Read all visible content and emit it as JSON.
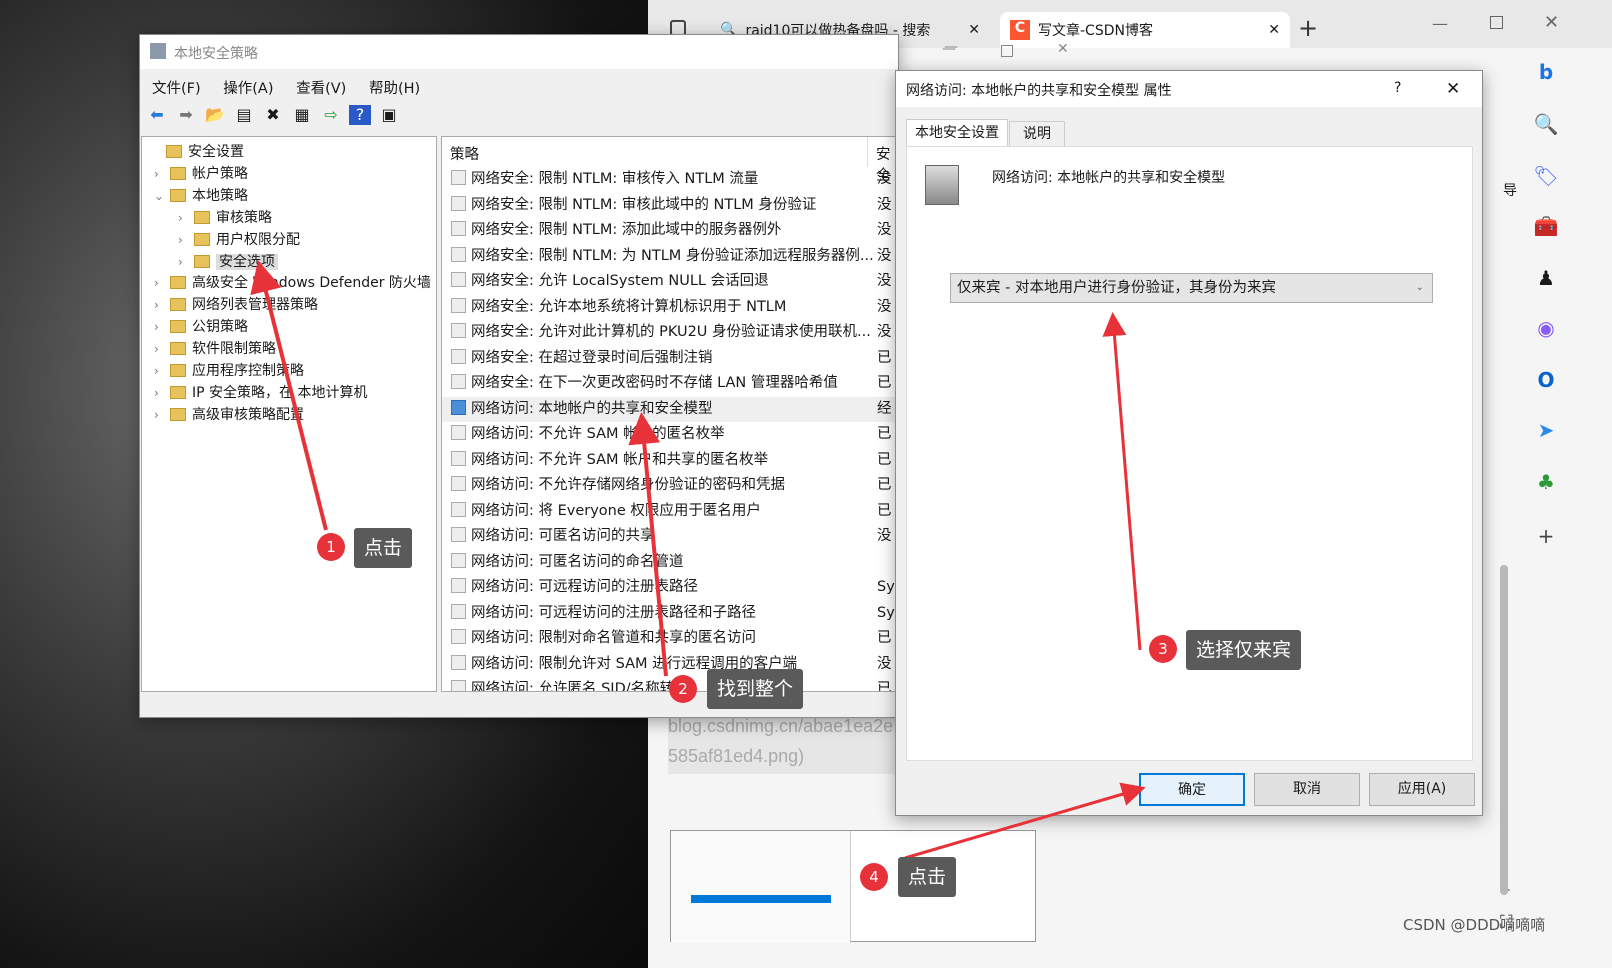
{
  "browser": {
    "tabs": [
      {
        "label": "raid10可以做热备盘吗 - 搜索",
        "icon": "search-icon"
      },
      {
        "label": "写文章-CSDN博客",
        "icon": "csdn-icon"
      }
    ],
    "new_tab": "+",
    "content_text_1": "blog.csdnimg.cn/abae1ea2e",
    "content_text_2": "585af81ed4.png)",
    "side_label": "导",
    "sidebar_icons": [
      "bing-icon",
      "search-icon",
      "tag-icon",
      "toolbox-icon",
      "chess-icon",
      "office-icon",
      "outlook-icon",
      "send-icon",
      "tree-icon",
      "plus-icon"
    ]
  },
  "mmc": {
    "title": "本地安全策略",
    "menu": [
      "文件(F)",
      "操作(A)",
      "查看(V)",
      "帮助(H)"
    ],
    "tree": [
      {
        "label": "安全设置",
        "level": 0
      },
      {
        "label": "帐户策略",
        "level": 1
      },
      {
        "label": "本地策略",
        "level": 1,
        "expanded": true
      },
      {
        "label": "审核策略",
        "level": 2
      },
      {
        "label": "用户权限分配",
        "level": 2
      },
      {
        "label": "安全选项",
        "level": 2,
        "selected": true
      },
      {
        "label": "高级安全 Windows Defender 防火墙",
        "level": 1
      },
      {
        "label": "网络列表管理器策略",
        "level": 1
      },
      {
        "label": "公钥策略",
        "level": 1
      },
      {
        "label": "软件限制策略",
        "level": 1
      },
      {
        "label": "应用程序控制策略",
        "level": 1
      },
      {
        "label": "IP 安全策略，在 本地计算机",
        "level": 1
      },
      {
        "label": "高级审核策略配置",
        "level": 1
      }
    ],
    "columns": [
      "策略",
      "安全"
    ],
    "rows": [
      {
        "policy": "网络安全: 限制 NTLM: 审核传入 NTLM 流量",
        "setting": "没"
      },
      {
        "policy": "网络安全: 限制 NTLM: 审核此域中的 NTLM 身份验证",
        "setting": "没"
      },
      {
        "policy": "网络安全: 限制 NTLM: 添加此域中的服务器例外",
        "setting": "没"
      },
      {
        "policy": "网络安全: 限制 NTLM: 为 NTLM 身份验证添加远程服务器例...",
        "setting": "没"
      },
      {
        "policy": "网络安全: 允许 LocalSystem NULL 会话回退",
        "setting": "没"
      },
      {
        "policy": "网络安全: 允许本地系统将计算机标识用于 NTLM",
        "setting": "没"
      },
      {
        "policy": "网络安全: 允许对此计算机的 PKU2U 身份验证请求使用联机...",
        "setting": "没"
      },
      {
        "policy": "网络安全: 在超过登录时间后强制注销",
        "setting": "已"
      },
      {
        "policy": "网络安全: 在下一次更改密码时不存储 LAN 管理器哈希值",
        "setting": "已"
      },
      {
        "policy": "网络访问: 本地帐户的共享和安全模型",
        "setting": "经",
        "selected": true
      },
      {
        "policy": "网络访问: 不允许 SAM 帐户的匿名枚举",
        "setting": "已"
      },
      {
        "policy": "网络访问: 不允许 SAM 帐户和共享的匿名枚举",
        "setting": "已"
      },
      {
        "policy": "网络访问: 不允许存储网络身份验证的密码和凭据",
        "setting": "已"
      },
      {
        "policy": "网络访问: 将 Everyone 权限应用于匿名用户",
        "setting": "已"
      },
      {
        "policy": "网络访问: 可匿名访问的共享",
        "setting": "没"
      },
      {
        "policy": "网络访问: 可匿名访问的命名管道",
        "setting": ""
      },
      {
        "policy": "网络访问: 可远程访问的注册表路径",
        "setting": "Sys"
      },
      {
        "policy": "网络访问: 可远程访问的注册表路径和子路径",
        "setting": "Sys"
      },
      {
        "policy": "网络访问: 限制对命名管道和共享的匿名访问",
        "setting": "已"
      },
      {
        "policy": "网络访问: 限制允许对 SAM 进行远程调用的客户端",
        "setting": "没"
      },
      {
        "policy": "网络访问: 允许匿名 SID/名称转换",
        "setting": "已"
      }
    ]
  },
  "dialog": {
    "title": "网络访问: 本地帐户的共享和安全模型 属性",
    "help": "?",
    "tabs": [
      "本地安全设置",
      "说明"
    ],
    "policy_name": "网络访问: 本地帐户的共享和安全模型",
    "select_value": "仅来宾 - 对本地用户进行身份验证，其身份为来宾",
    "buttons": {
      "ok": "确定",
      "cancel": "取消",
      "apply": "应用(A)"
    }
  },
  "annotations": [
    {
      "number": "1",
      "text": "点击"
    },
    {
      "number": "2",
      "text": "找到整个"
    },
    {
      "number": "3",
      "text": "选择仅来宾"
    },
    {
      "number": "4",
      "text": "点击"
    }
  ],
  "annotation_color": "#e8323a",
  "watermark": "CSDN @DDD嘀嘀嘀"
}
